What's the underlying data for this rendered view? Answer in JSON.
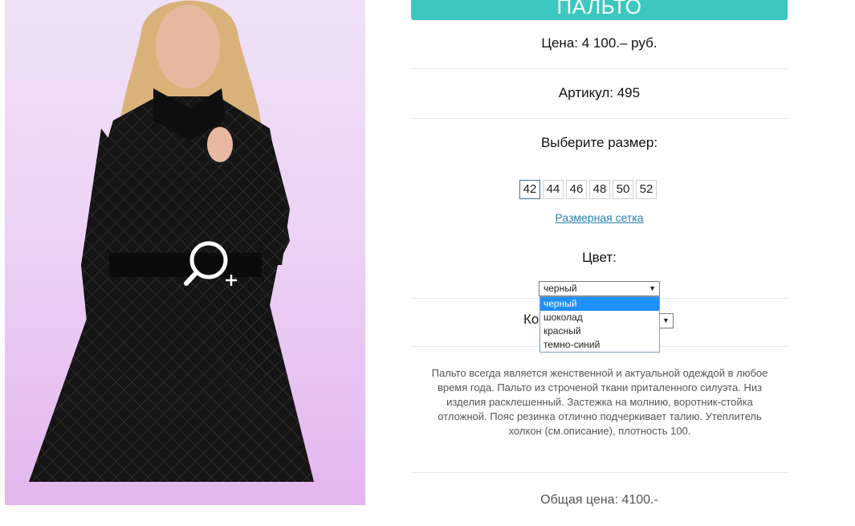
{
  "product": {
    "title": "ПАЛЬТО",
    "price_label": "Цена: 4 100.– руб.",
    "article_label": "Артикул: 495",
    "choose_size_label": "Выберите размер:",
    "sizes": [
      "42",
      "44",
      "46",
      "48",
      "50",
      "52"
    ],
    "selected_size": "42",
    "size_chart_link": "Размерная сетка",
    "color_label": "Цвет:",
    "color_selected": "черный",
    "color_options": [
      "черный",
      "шоколад",
      "красный",
      "темно-синий"
    ],
    "quantity_label_partial": "Ко",
    "description": "Пальто всегда является женственной и актуальной одеждой в любое время года. Пальто из строченой ткани приталенного силуэта. Низ изделия расклешенный. Застежка на молнию, воротник-стойка отложной. Пояс резинка отлично подчеркивает талию. Утеплитель холкон (см.описание), плотность 100.",
    "total_label": "Общая цена: 4100.-"
  },
  "colors": {
    "accent": "#3cc8c0",
    "link": "#2a7fb0",
    "dropdown_highlight": "#1e90ff"
  },
  "icons": {
    "zoom": "zoom-in-icon",
    "select_arrow": "▼"
  }
}
